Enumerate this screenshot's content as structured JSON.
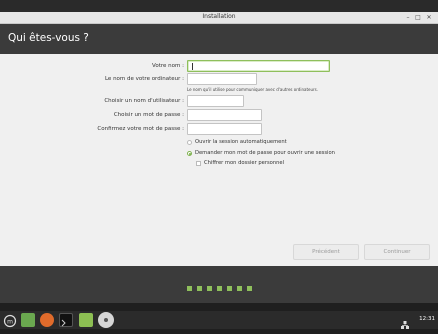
{
  "window": {
    "title": "Installation",
    "minimize": "–",
    "maximize": "□",
    "close": "✕"
  },
  "header": {
    "title": "Qui êtes-vous ?"
  },
  "form": {
    "name_label": "Votre nom :",
    "name_value": "",
    "computer_label": "Le nom de votre ordinateur :",
    "computer_value": "",
    "computer_hint": "Le nom qu'il utilise pour communiquer avec d'autres ordinateurs.",
    "username_label": "Choisir un nom d'utilisateur :",
    "username_value": "",
    "password_label": "Choisir un mot de passe :",
    "password_value": "",
    "confirm_label": "Confirmez votre mot de passe :",
    "confirm_value": "",
    "opt_autologin": "Ouvrir la session automatiquement",
    "opt_require_password": "Demander mon mot de passe pour ouvrir une session",
    "opt_encrypt_home": "Chiffrer mon dossier personnel",
    "selected_option": "require_password",
    "encrypt_home_checked": false
  },
  "buttons": {
    "back": "Précédent",
    "continue": "Continuer"
  },
  "progress": {
    "total_steps": 8,
    "current_step": 6,
    "accent": "#8fbf5c"
  },
  "taskbar": {
    "apps": [
      "menu-icon",
      "file-manager-icon",
      "firefox-icon",
      "terminal-icon",
      "files-icon",
      "installer-icon"
    ],
    "clock": "12:31"
  }
}
